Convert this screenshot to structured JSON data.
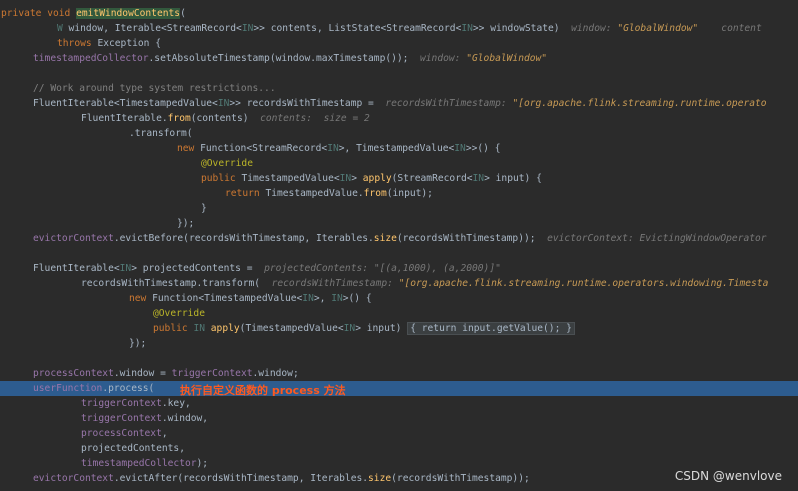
{
  "code_lines": [
    {
      "indent": 1,
      "tokens": [
        {
          "t": "private void ",
          "c": "kw"
        },
        {
          "t": "emitWindowContents",
          "c": "hlmeth"
        },
        {
          "t": "("
        }
      ]
    },
    {
      "indent": 57,
      "tokens": [
        {
          "t": "W",
          "c": "tp"
        },
        {
          "t": " window, Iterable<StreamRecord<"
        },
        {
          "t": "IN",
          "c": "tp"
        },
        {
          "t": ">> contents, ListState<StreamRecord<"
        },
        {
          "t": "IN",
          "c": "tp"
        },
        {
          "t": ">> windowState)  "
        },
        {
          "t": "window: ",
          "c": "hint"
        },
        {
          "t": "\"GlobalWindow\"",
          "c": "hintval"
        },
        {
          "t": "    content",
          "c": "hint"
        }
      ]
    },
    {
      "indent": 57,
      "tokens": [
        {
          "t": "throws ",
          "c": "kw"
        },
        {
          "t": "Exception {"
        }
      ]
    },
    {
      "indent": 33,
      "tokens": [
        {
          "t": "timestampedCollector",
          "c": "fld"
        },
        {
          "t": ".setAbsoluteTimestamp(window.maxTimestamp());  "
        },
        {
          "t": "window: ",
          "c": "hint"
        },
        {
          "t": "\"GlobalWindow\"",
          "c": "hintval"
        }
      ]
    },
    {
      "indent": 0,
      "tokens": []
    },
    {
      "indent": 33,
      "tokens": [
        {
          "t": "// Work around type system restrictions...",
          "c": "cm"
        }
      ]
    },
    {
      "indent": 33,
      "tokens": [
        {
          "t": "FluentIterable<TimestampedValue<"
        },
        {
          "t": "IN",
          "c": "tp"
        },
        {
          "t": ">> recordsWithTimestamp =  "
        },
        {
          "t": "recordsWithTimestamp: ",
          "c": "hint"
        },
        {
          "t": "\"[org.apache.flink.streaming.runtime.operato",
          "c": "hintval"
        }
      ]
    },
    {
      "indent": 81,
      "tokens": [
        {
          "t": "FluentIterable."
        },
        {
          "t": "from",
          "c": "fn"
        },
        {
          "t": "(contents)  "
        },
        {
          "t": "contents:  size = 2",
          "c": "hint"
        }
      ]
    },
    {
      "indent": 129,
      "tokens": [
        {
          "t": ".transform("
        }
      ]
    },
    {
      "indent": 177,
      "tokens": [
        {
          "t": "new ",
          "c": "kw"
        },
        {
          "t": "Function<StreamRecord<"
        },
        {
          "t": "IN",
          "c": "tp"
        },
        {
          "t": ">, TimestampedValue<"
        },
        {
          "t": "IN",
          "c": "tp"
        },
        {
          "t": ">>() {"
        }
      ]
    },
    {
      "indent": 201,
      "tokens": [
        {
          "t": "@Override",
          "c": "ann"
        }
      ]
    },
    {
      "indent": 201,
      "tokens": [
        {
          "t": "public ",
          "c": "kw"
        },
        {
          "t": "TimestampedValue<"
        },
        {
          "t": "IN",
          "c": "tp"
        },
        {
          "t": "> "
        },
        {
          "t": "apply",
          "c": "fn"
        },
        {
          "t": "(StreamRecord<"
        },
        {
          "t": "IN",
          "c": "tp"
        },
        {
          "t": "> input) {"
        }
      ]
    },
    {
      "indent": 225,
      "tokens": [
        {
          "t": "return ",
          "c": "kw"
        },
        {
          "t": "TimestampedValue."
        },
        {
          "t": "from",
          "c": "fn"
        },
        {
          "t": "(input);"
        }
      ]
    },
    {
      "indent": 201,
      "tokens": [
        {
          "t": "}"
        }
      ]
    },
    {
      "indent": 177,
      "tokens": [
        {
          "t": "});"
        }
      ]
    },
    {
      "indent": 33,
      "tokens": [
        {
          "t": "evictorContext",
          "c": "fld"
        },
        {
          "t": ".evictBefore(recordsWithTimestamp, Iterables."
        },
        {
          "t": "size",
          "c": "fn"
        },
        {
          "t": "(recordsWithTimestamp));  "
        },
        {
          "t": "evictorContext: EvictingWindowOperator",
          "c": "hint"
        }
      ]
    },
    {
      "indent": 0,
      "tokens": []
    },
    {
      "indent": 33,
      "tokens": [
        {
          "t": "FluentIterable<"
        },
        {
          "t": "IN",
          "c": "tp"
        },
        {
          "t": "> projectedContents =  "
        },
        {
          "t": "projectedContents: ",
          "c": "hint"
        },
        {
          "t": "\"[(a,1000), (a,2000)]\"",
          "c": "hint"
        }
      ]
    },
    {
      "indent": 81,
      "tokens": [
        {
          "t": "recordsWithTimestamp.transform(  "
        },
        {
          "t": "recordsWithTimestamp: ",
          "c": "hint"
        },
        {
          "t": "\"[org.apache.flink.streaming.runtime.operators.windowing.Timesta",
          "c": "hintval"
        }
      ]
    },
    {
      "indent": 129,
      "tokens": [
        {
          "t": "new ",
          "c": "kw"
        },
        {
          "t": "Function<TimestampedValue<"
        },
        {
          "t": "IN",
          "c": "tp"
        },
        {
          "t": ">, "
        },
        {
          "t": "IN",
          "c": "tp"
        },
        {
          "t": ">() {"
        }
      ]
    },
    {
      "indent": 153,
      "tokens": [
        {
          "t": "@Override",
          "c": "ann"
        }
      ]
    },
    {
      "indent": 153,
      "tokens": [
        {
          "t": "public ",
          "c": "kw"
        },
        {
          "t": "IN",
          "c": "tp"
        },
        {
          "t": " "
        },
        {
          "t": "apply",
          "c": "fn"
        },
        {
          "t": "(TimestampedValue<"
        },
        {
          "t": "IN",
          "c": "tp"
        },
        {
          "t": "> input) "
        },
        {
          "t": "{ return input.getValue(); }",
          "c": "fold"
        }
      ]
    },
    {
      "indent": 129,
      "tokens": [
        {
          "t": "});"
        }
      ]
    },
    {
      "indent": 0,
      "tokens": []
    },
    {
      "indent": 33,
      "tokens": [
        {
          "t": "processContext",
          "c": "fld"
        },
        {
          "t": ".window = "
        },
        {
          "t": "triggerContext",
          "c": "fld"
        },
        {
          "t": ".window;"
        }
      ]
    },
    {
      "indent": 33,
      "highlight": true,
      "tokens": [
        {
          "t": "userFunction",
          "c": "fld"
        },
        {
          "t": ".process("
        }
      ]
    },
    {
      "indent": 81,
      "tokens": [
        {
          "t": "triggerContext",
          "c": "fld"
        },
        {
          "t": ".key,"
        }
      ]
    },
    {
      "indent": 81,
      "tokens": [
        {
          "t": "triggerContext",
          "c": "fld"
        },
        {
          "t": ".window,"
        }
      ]
    },
    {
      "indent": 81,
      "tokens": [
        {
          "t": "processContext",
          "c": "fld"
        },
        {
          "t": ","
        }
      ]
    },
    {
      "indent": 81,
      "tokens": [
        {
          "t": "projectedContents,"
        }
      ]
    },
    {
      "indent": 81,
      "tokens": [
        {
          "t": "timestampedCollector",
          "c": "fld"
        },
        {
          "t": ");"
        }
      ]
    },
    {
      "indent": 33,
      "tokens": [
        {
          "t": "evictorContext",
          "c": "fld"
        },
        {
          "t": ".evictAfter(recordsWithTimestamp, Iterables."
        },
        {
          "t": "size",
          "c": "fn"
        },
        {
          "t": "(recordsWithTimestamp));"
        }
      ]
    }
  ],
  "annotation": {
    "text": "执行自定义函数的 process 方法"
  },
  "watermark": {
    "text": "CSDN @wenvlove"
  }
}
